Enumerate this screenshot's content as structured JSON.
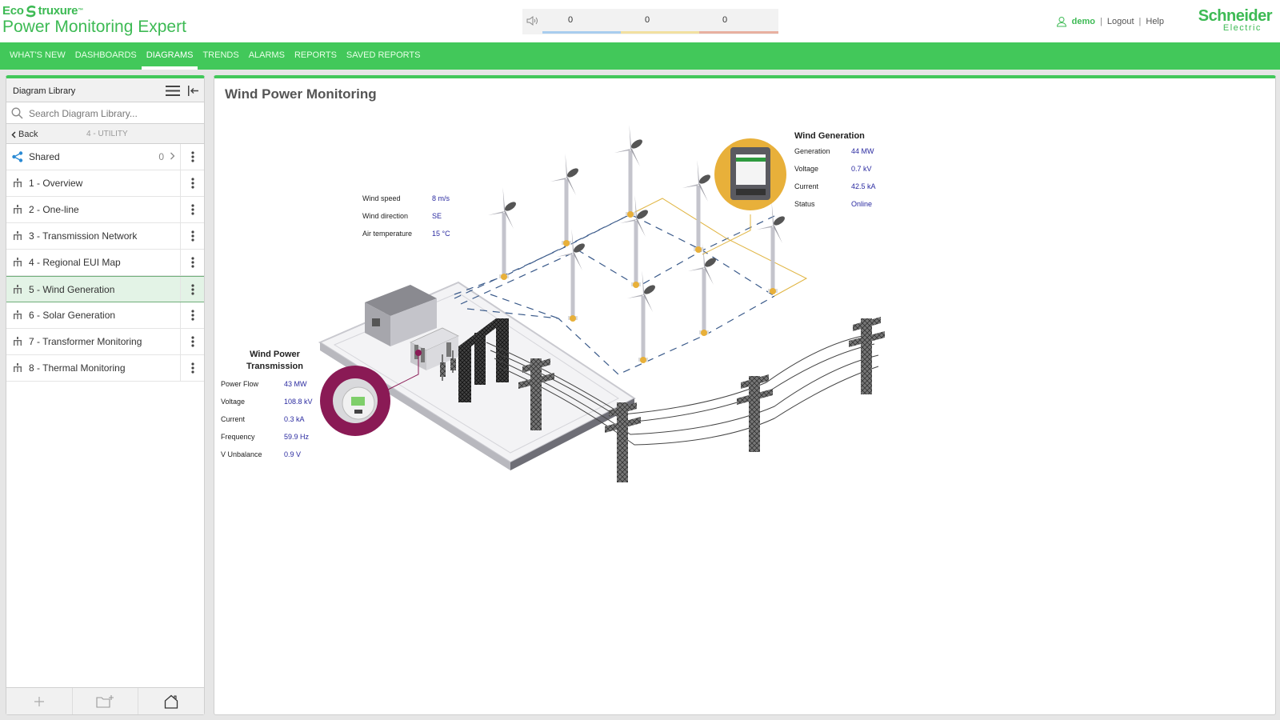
{
  "header": {
    "brand_top": "Eco",
    "brand_top_rest": "truxure",
    "product_name": "Power Monitoring Expert",
    "alarm_counts": [
      "0",
      "0",
      "0"
    ],
    "alarm_colors": [
      "#a9cdee",
      "#f2e0a0",
      "#e8b0a0"
    ],
    "user": "demo",
    "logout": "Logout",
    "help": "Help",
    "separator": "|",
    "vendor_line1": "Schneider",
    "vendor_line2": "Electric"
  },
  "nav": {
    "items": [
      "What's New",
      "Dashboards",
      "Diagrams",
      "Trends",
      "Alarms",
      "Reports",
      "Saved Reports"
    ],
    "active": "Diagrams"
  },
  "sidebar": {
    "title": "Diagram Library",
    "search_placeholder": "Search Diagram Library...",
    "back_label": "Back",
    "breadcrumb": "4 - UTILITY",
    "shared": {
      "label": "Shared",
      "count": "0"
    },
    "items": [
      {
        "label": "1 - Overview"
      },
      {
        "label": "2 - One-line"
      },
      {
        "label": "3 - Transmission Network"
      },
      {
        "label": "4 - Regional EUI Map"
      },
      {
        "label": "5 - Wind Generation",
        "selected": true
      },
      {
        "label": "6 - Solar Generation"
      },
      {
        "label": "7 - Transformer Monitoring"
      },
      {
        "label": "8 - Thermal Monitoring"
      }
    ],
    "footer": [
      "add-icon",
      "new-folder-icon",
      "home-icon"
    ]
  },
  "main": {
    "title": "Wind Power Monitoring",
    "weather": {
      "rows": [
        {
          "label": "Wind speed",
          "value": "8 m/s"
        },
        {
          "label": "Wind direction",
          "value": "SE"
        },
        {
          "label": "Air temperature",
          "value": "15 °C"
        }
      ]
    },
    "generation": {
      "title": "Wind Generation",
      "rows": [
        {
          "label": "Generation",
          "value": "44 MW"
        },
        {
          "label": "Voltage",
          "value": "0.7 kV"
        },
        {
          "label": "Current",
          "value": "42.5 kA"
        },
        {
          "label": "Status",
          "value": "Online"
        }
      ]
    },
    "transmission": {
      "title_line1": "Wind Power",
      "title_line2": "Transmission",
      "rows": [
        {
          "label": "Power Flow",
          "value": "43 MW"
        },
        {
          "label": "Voltage",
          "value": "108.8 kV"
        },
        {
          "label": "Current",
          "value": "0.3 kA"
        },
        {
          "label": "Frequency",
          "value": "59.9 Hz"
        },
        {
          "label": "V Unbalance",
          "value": "0.9 V"
        }
      ]
    },
    "colors": {
      "generation_accent": "#e8b03a",
      "transmission_accent": "#8a1a55",
      "cable_dash": "#3a5a8a"
    }
  }
}
